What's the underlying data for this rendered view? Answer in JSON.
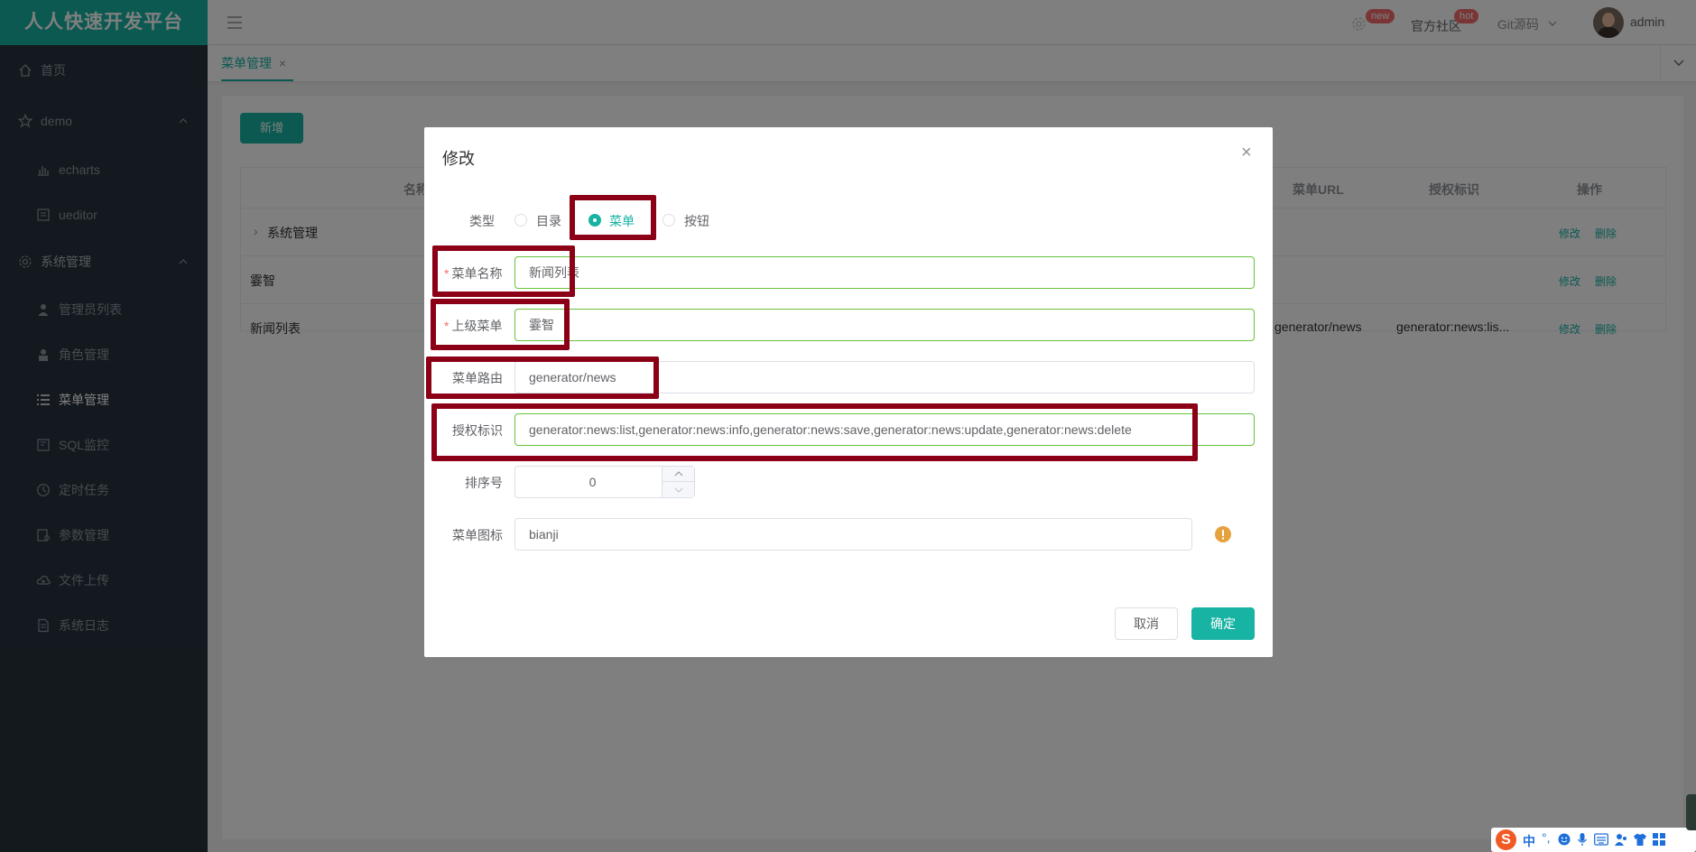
{
  "app": {
    "brand": "人人快速开发平台"
  },
  "sidebar": {
    "items": [
      {
        "label": "首页",
        "icon": "home-icon"
      },
      {
        "label": "demo",
        "icon": "star-icon"
      },
      {
        "label": "echarts",
        "icon": "bar-chart-icon"
      },
      {
        "label": "ueditor",
        "icon": "editor-icon"
      },
      {
        "label": "系统管理",
        "icon": "gear-icon"
      },
      {
        "label": "管理员列表",
        "icon": "user-icon"
      },
      {
        "label": "角色管理",
        "icon": "role-icon"
      },
      {
        "label": "菜单管理",
        "icon": "list-icon"
      },
      {
        "label": "SQL监控",
        "icon": "sql-icon"
      },
      {
        "label": "定时任务",
        "icon": "clock-icon"
      },
      {
        "label": "参数管理",
        "icon": "config-icon"
      },
      {
        "label": "文件上传",
        "icon": "cloud-upload-icon"
      },
      {
        "label": "系统日志",
        "icon": "log-icon"
      }
    ]
  },
  "topbar": {
    "new_badge": "new",
    "community": "官方社区",
    "hot_badge": "hot",
    "git": "Git源码",
    "user": "admin"
  },
  "tabs": [
    {
      "label": "菜单管理",
      "close": "×"
    }
  ],
  "page": {
    "add_button": "新增",
    "table": {
      "columns": [
        "名称",
        "菜单URL",
        "授权标识",
        "操作"
      ],
      "rows": [
        {
          "name": "系统管理",
          "url": "",
          "perms": "",
          "edit": "修改",
          "delete": "删除"
        },
        {
          "name": "霎智",
          "url": "",
          "perms": "",
          "edit": "修改",
          "delete": "删除"
        },
        {
          "name": "新闻列表",
          "url": "generator/news",
          "perms": "generator:news:lis...",
          "edit": "修改",
          "delete": "删除"
        }
      ]
    }
  },
  "dialog": {
    "title": "修改",
    "close": "×",
    "type_label": "类型",
    "type_options": [
      "目录",
      "菜单",
      "按钮"
    ],
    "type_selected": "菜单",
    "name_label": "菜单名称",
    "name_value": "新闻列表",
    "parent_label": "上级菜单",
    "parent_value": "霎智",
    "route_label": "菜单路由",
    "route_value": "generator/news",
    "perms_label": "授权标识",
    "perms_value": "generator:news:list,generator:news:info,generator:news:save,generator:news:update,generator:news:delete",
    "order_label": "排序号",
    "order_value": "0",
    "icon_label": "菜单图标",
    "icon_value": "bianji",
    "cancel": "取消",
    "confirm": "确定"
  },
  "colors": {
    "primary": "#17b3a3",
    "sidebar": "#263238",
    "highlight": "#8b0016",
    "success": "#67c23a",
    "warning": "#e6a23c"
  }
}
